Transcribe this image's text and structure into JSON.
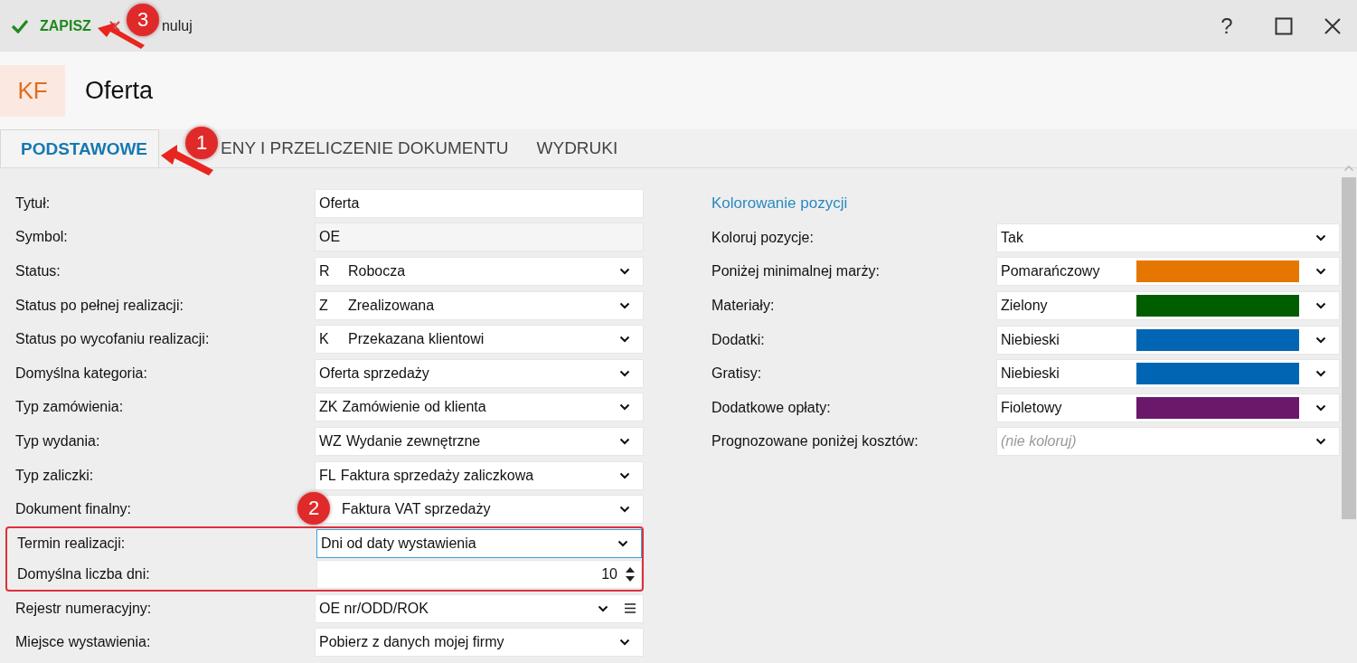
{
  "toolbar": {
    "save": "ZAPISZ",
    "cancel": "nuluj",
    "help": "?"
  },
  "header": {
    "badge": "KF",
    "title": "Oferta"
  },
  "tabs": [
    {
      "label": "PODSTAWOWE",
      "selected": true
    },
    {
      "label": "ENY I PRZELICZENIE DOKUMENTU",
      "selected": false
    },
    {
      "label": "WYDRUKI",
      "selected": false
    }
  ],
  "fields": [
    {
      "label": "Tytuł:",
      "kind": "text",
      "value": "Oferta"
    },
    {
      "label": "Symbol:",
      "kind": "readonly",
      "value": "OE"
    },
    {
      "label": "Status:",
      "kind": "select",
      "code": "R",
      "wide_code": true,
      "value": "Robocza"
    },
    {
      "label": "Status po pełnej realizacji:",
      "kind": "select",
      "code": "Z",
      "wide_code": true,
      "value": "Zrealizowana"
    },
    {
      "label": "Status po wycofaniu realizacji:",
      "kind": "select",
      "code": "K",
      "wide_code": true,
      "value": "Przekazana klientowi"
    },
    {
      "label": "Domyślna kategoria:",
      "kind": "select",
      "value": "Oferta sprzedaży"
    },
    {
      "label": "Typ zamówienia:",
      "kind": "select",
      "code": "ZK",
      "value": "Zamówienie od klienta"
    },
    {
      "label": "Typ wydania:",
      "kind": "select",
      "code": "WZ",
      "value": "Wydanie zewnętrzne"
    },
    {
      "label": "Typ zaliczki:",
      "kind": "select",
      "code": "FL",
      "value": "Faktura sprzedaży zaliczkowa"
    },
    {
      "label": "Dokument finalny:",
      "kind": "select",
      "code_hidden": true,
      "value": "Faktura VAT sprzedaży"
    },
    {
      "label": "Termin realizacji:",
      "kind": "select",
      "value": "Dni od daty wystawienia",
      "focused": true
    },
    {
      "label": "Domyślna liczba dni:",
      "kind": "number",
      "value": "10"
    },
    {
      "label": "Rejestr numeracyjny:",
      "kind": "select_menu",
      "value": "OE nr/ODD/ROK"
    },
    {
      "label": "Miejsce wystawienia:",
      "kind": "select",
      "value": "Pobierz z danych mojej firmy"
    }
  ],
  "coloring": {
    "heading": "Kolorowanie pozycji",
    "rows": [
      {
        "label": "Koloruj pozycje:",
        "kind": "select",
        "value": "Tak"
      },
      {
        "label": "Poniżej minimalnej marży:",
        "kind": "color",
        "value": "Pomarańczowy",
        "color": "#e57700"
      },
      {
        "label": "Materiały:",
        "kind": "color",
        "value": "Zielony",
        "color": "#005e00"
      },
      {
        "label": "Dodatki:",
        "kind": "color",
        "value": "Niebieski",
        "color": "#0066b3"
      },
      {
        "label": "Gratisy:",
        "kind": "color",
        "value": "Niebieski",
        "color": "#0066b3"
      },
      {
        "label": "Dodatkowe opłaty:",
        "kind": "color",
        "value": "Fioletowy",
        "color": "#6b186b"
      },
      {
        "label": "Prognozowane poniżej kosztów:",
        "kind": "placeholder",
        "placeholder": "(nie koloruj)"
      }
    ]
  },
  "callouts": [
    {
      "number": "3"
    },
    {
      "number": "1"
    },
    {
      "number": "2"
    }
  ]
}
